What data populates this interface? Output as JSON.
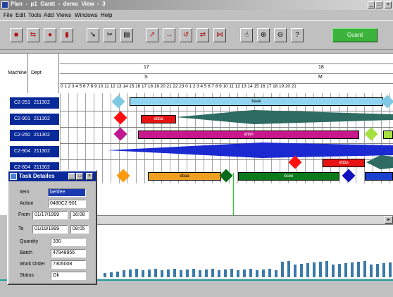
{
  "window": {
    "title": "Plan  -  p1  Gantt  -  demo  View  -  3"
  },
  "menu": [
    "File",
    "Edit",
    "Tools",
    "Add",
    "Views",
    "Windows",
    "Help"
  ],
  "toolbar": {
    "tools": [
      "save-icon",
      "move-icon",
      "tool-icon",
      "flag-icon",
      "pointer-icon",
      "cut-icon",
      "paste-icon",
      "pen-icon",
      "arrow-right-icon",
      "loop-icon",
      "swap-icon",
      "link-icon",
      "hand-icon",
      "zoom-in-icon",
      "zoom-out-icon",
      "help-icon"
    ],
    "guard_label": "Guard",
    "guard_color": "#3cb43c"
  },
  "header": {
    "machine": "Machine",
    "dept": "Dept",
    "day1": "17",
    "day2": "18",
    "day1_letter": "S",
    "day2_letter": "M",
    "hours": "0 1 2 3 4 5 6 7 8 9 10 11 12 13 14 15 16 17 18 19 20 21 22 23 0 1 2 3 4 5 6 7 8 9 10 11 12 13 14 15 16 17 18 19 20 21"
  },
  "rows": [
    {
      "machine": "C2-251",
      "dept": "211302"
    },
    {
      "machine": "C2-901",
      "dept": "211302"
    },
    {
      "machine": "C2-250",
      "dept": "211302"
    },
    {
      "machine": "C2-904",
      "dept": "211302"
    },
    {
      "machine": "C2-804",
      "dept": "211302"
    }
  ],
  "tasks": [
    "baae",
    "ebba",
    "ahbh",
    "ebba",
    "ebaa",
    "bcee"
  ],
  "task_panel": {
    "title": "Task Detailes",
    "item_label": "Item",
    "item": "behfee",
    "action_label": "Action",
    "action": "0480C2-901",
    "from_label": "From",
    "from_date": "01/17/1999",
    "from_time": "16:08",
    "to_label": "To",
    "to_date": "01/19/1999",
    "to_time": "08:05",
    "quantity_label": "Quantity",
    "quantity": "330",
    "batch_label": "Batch",
    "batch": "47948956",
    "workorder_label": "Work Order",
    "workorder": "7305008",
    "status_label": "Status",
    "status": "Ok"
  }
}
